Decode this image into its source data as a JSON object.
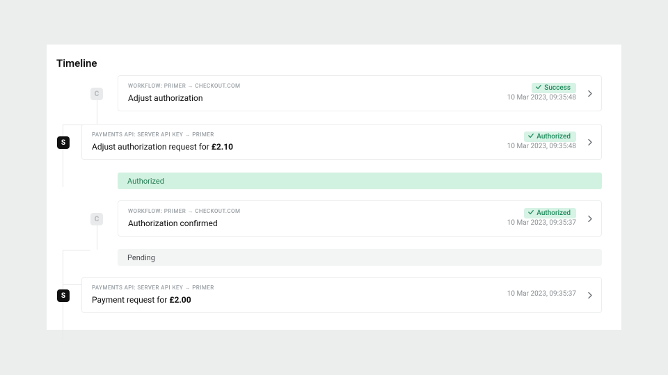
{
  "panel_title": "Timeline",
  "eyebrow_workflow": "WORKFLOW: PRIMER → CHECKOUT.COM",
  "eyebrow_payments": "PAYMENTS API: SERVER API KEY → PRIMER",
  "badge_c": "C",
  "badge_s": "S",
  "card1": {
    "title": "Adjust authorization",
    "status": "Success",
    "timestamp": "10 Mar 2023, 09:35:48"
  },
  "card2": {
    "title_prefix": "Adjust authorization request for ",
    "title_amount": "£2.10",
    "status": "Authorized",
    "timestamp": "10 Mar 2023, 09:35:48"
  },
  "bar_authorized": "Authorized",
  "card3": {
    "title": "Authorization confirmed",
    "status": "Authorized",
    "timestamp": "10 Mar 2023, 09:35:37"
  },
  "bar_pending": "Pending",
  "card4": {
    "title_prefix": "Payment request for ",
    "title_amount": "£2.00",
    "timestamp": "10 Mar 2023, 09:35:37"
  }
}
